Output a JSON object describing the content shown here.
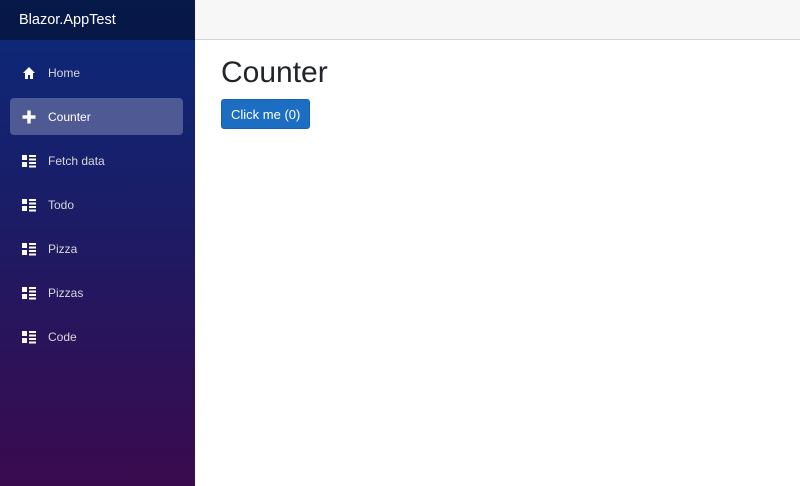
{
  "app": {
    "title": "Blazor.AppTest"
  },
  "nav": {
    "items": [
      {
        "label": "Home",
        "icon": "home-icon",
        "active": false
      },
      {
        "label": "Counter",
        "icon": "plus-icon",
        "active": true
      },
      {
        "label": "Fetch data",
        "icon": "list-icon",
        "active": false
      },
      {
        "label": "Todo",
        "icon": "list-icon",
        "active": false
      },
      {
        "label": "Pizza",
        "icon": "list-icon",
        "active": false
      },
      {
        "label": "Pizzas",
        "icon": "list-icon",
        "active": false
      },
      {
        "label": "Code",
        "icon": "list-icon",
        "active": false
      }
    ]
  },
  "page": {
    "title": "Counter",
    "button_label": "Click me (0)"
  },
  "colors": {
    "primary": "#1b6ec2",
    "sidebar_top": "#0a2a7a",
    "sidebar_bottom": "#3a0a4e"
  }
}
